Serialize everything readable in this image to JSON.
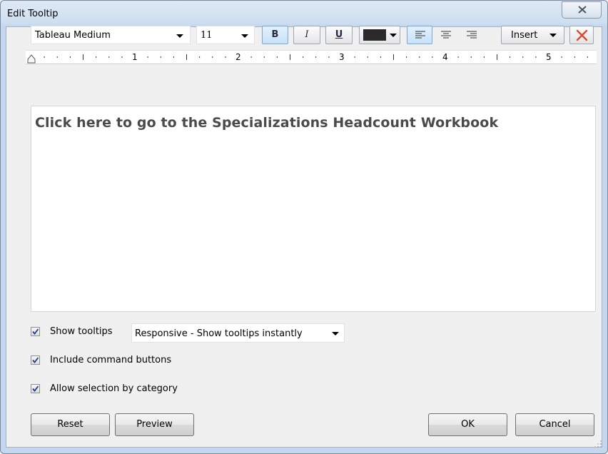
{
  "window": {
    "title": "Edit Tooltip"
  },
  "toolbar": {
    "font": "Tableau Medium",
    "size": "11",
    "bold": "B",
    "italic": "I",
    "underline": "U",
    "color": "#2a2a2a",
    "insert_label": "Insert"
  },
  "ruler": {
    "labels": [
      "1",
      "2",
      "3",
      "4",
      "5"
    ]
  },
  "editor": {
    "text": "Click here to go to the Specializations Headcount Workbook"
  },
  "options": {
    "show_tooltips_label": "Show tooltips",
    "show_tooltips_checked": true,
    "mode_value": "Responsive - Show tooltips instantly",
    "include_buttons_label": "Include command buttons",
    "include_buttons_checked": true,
    "allow_selection_label": "Allow selection by category",
    "allow_selection_checked": true
  },
  "buttons": {
    "reset": "Reset",
    "preview": "Preview",
    "ok": "OK",
    "cancel": "Cancel"
  }
}
